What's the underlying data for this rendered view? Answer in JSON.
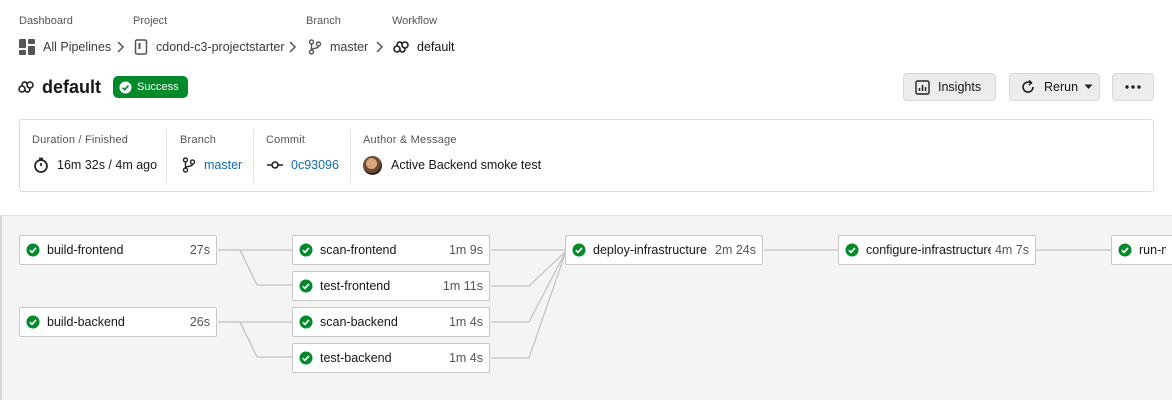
{
  "breadcrumb": {
    "dashboard_label": "Dashboard",
    "project_label": "Project",
    "branch_label": "Branch",
    "workflow_label": "Workflow",
    "dashboard": "All Pipelines",
    "project": "cdond-c3-projectstarter",
    "branch": "master",
    "workflow": "default"
  },
  "header": {
    "title": "default",
    "status": "Success",
    "status_color": "#018a2a",
    "buttons": {
      "insights": "Insights",
      "rerun": "Rerun"
    }
  },
  "summary": {
    "duration_label": "Duration / Finished",
    "duration": "16m 32s / 4m ago",
    "branch_label": "Branch",
    "branch": "master",
    "commit_label": "Commit",
    "commit": "0c93096",
    "author_label": "Author & Message",
    "message": "Active Backend smoke test"
  },
  "jobs": [
    {
      "name": "build-frontend",
      "duration": "27s",
      "status": "success"
    },
    {
      "name": "build-backend",
      "duration": "26s",
      "status": "success"
    },
    {
      "name": "scan-frontend",
      "duration": "1m 9s",
      "status": "success"
    },
    {
      "name": "test-frontend",
      "duration": "1m 11s",
      "status": "success"
    },
    {
      "name": "scan-backend",
      "duration": "1m 4s",
      "status": "success"
    },
    {
      "name": "test-backend",
      "duration": "1m 4s",
      "status": "success"
    },
    {
      "name": "deploy-infrastructure",
      "duration": "2m 24s",
      "status": "success"
    },
    {
      "name": "configure-infrastructure",
      "duration": "4m 7s",
      "status": "success"
    },
    {
      "name": "run-migrations",
      "duration": "",
      "status": "success"
    }
  ]
}
